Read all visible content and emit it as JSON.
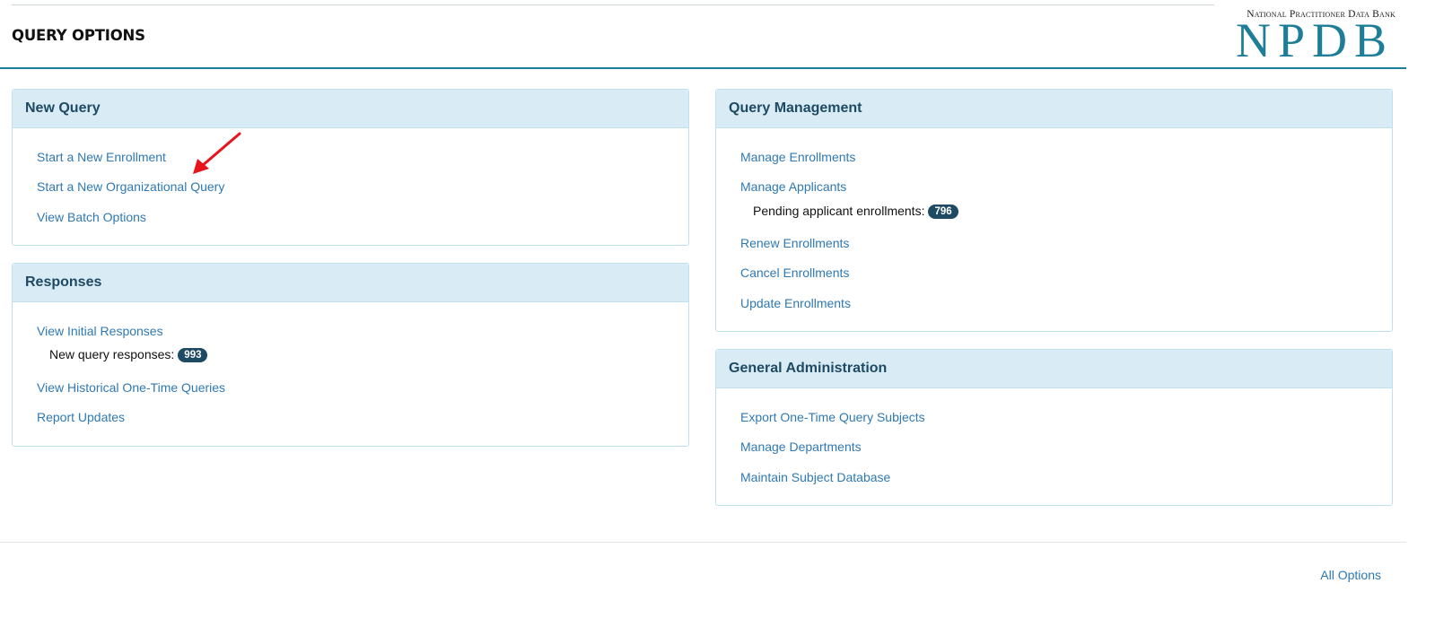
{
  "header": {
    "title": "QUERY OPTIONS",
    "logo_small": "National Practitioner Data Bank",
    "logo_big": "NPDB"
  },
  "new_query": {
    "title": "New Query",
    "links": [
      "Start a New Enrollment",
      "Start a New Organizational Query",
      "View Batch Options"
    ]
  },
  "responses": {
    "title": "Responses",
    "links": [
      "View Initial Responses",
      "View Historical One-Time Queries",
      "Report Updates"
    ],
    "note_label": "New query responses:",
    "note_count": "993"
  },
  "query_management": {
    "title": "Query Management",
    "links": [
      "Manage Enrollments",
      "Manage Applicants",
      "Renew Enrollments",
      "Cancel Enrollments",
      "Update Enrollments"
    ],
    "note_label": "Pending applicant enrollments:",
    "note_count": "796"
  },
  "general_admin": {
    "title": "General Administration",
    "links": [
      "Export One-Time Query Subjects",
      "Manage Departments",
      "Maintain Subject Database"
    ]
  },
  "footer": {
    "all_options": "All Options"
  },
  "colors": {
    "accent": "#1e7e98",
    "link": "#2f79b3",
    "panel_header": "#d9ecf6",
    "badge": "#1f4a63",
    "annotation_arrow": "#e8141b"
  },
  "annotation": {
    "icon": "red-arrow-icon"
  }
}
